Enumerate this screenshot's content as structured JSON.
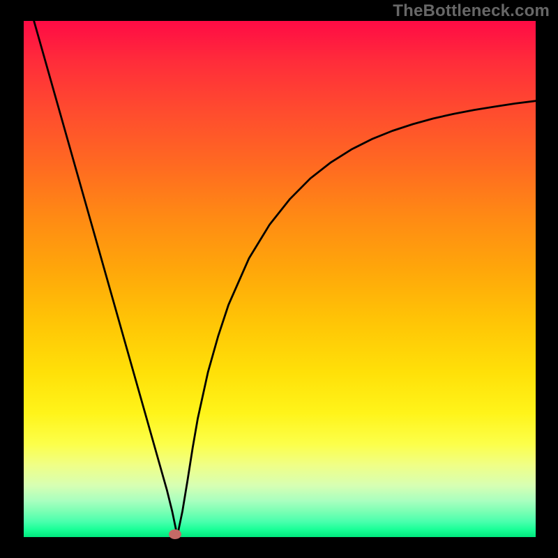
{
  "watermark": "TheBottleneck.com",
  "colors": {
    "frame_bg": "#000000",
    "gradient_top": "#ff0b45",
    "gradient_bottom": "#00e87e",
    "curve": "#000000",
    "dot": "#c46a66",
    "watermark": "#676767"
  },
  "chart_data": {
    "type": "line",
    "title": "",
    "xlabel": "",
    "ylabel": "",
    "xlim": [
      0,
      100
    ],
    "ylim": [
      0,
      100
    ],
    "grid": false,
    "legend": false,
    "series": [
      {
        "name": "curve",
        "x": [
          2,
          4,
          6,
          8,
          10,
          12,
          14,
          16,
          18,
          20,
          22,
          24,
          26,
          28,
          29,
          29.8,
          30.2,
          31,
          32,
          33,
          34,
          36,
          38,
          40,
          44,
          48,
          52,
          56,
          60,
          64,
          68,
          72,
          76,
          80,
          84,
          88,
          92,
          96,
          100
        ],
        "y": [
          100,
          93,
          86,
          79,
          72,
          65,
          58,
          51,
          44,
          37,
          30,
          23,
          16,
          9,
          5,
          1.2,
          1.2,
          5,
          11,
          17.3,
          23,
          32,
          39,
          45,
          54,
          60.5,
          65.5,
          69.5,
          72.6,
          75.1,
          77.1,
          78.7,
          80,
          81.1,
          82,
          82.75,
          83.4,
          84,
          84.5
        ]
      }
    ],
    "marker": {
      "x": 29.5,
      "y": 0.6
    }
  }
}
